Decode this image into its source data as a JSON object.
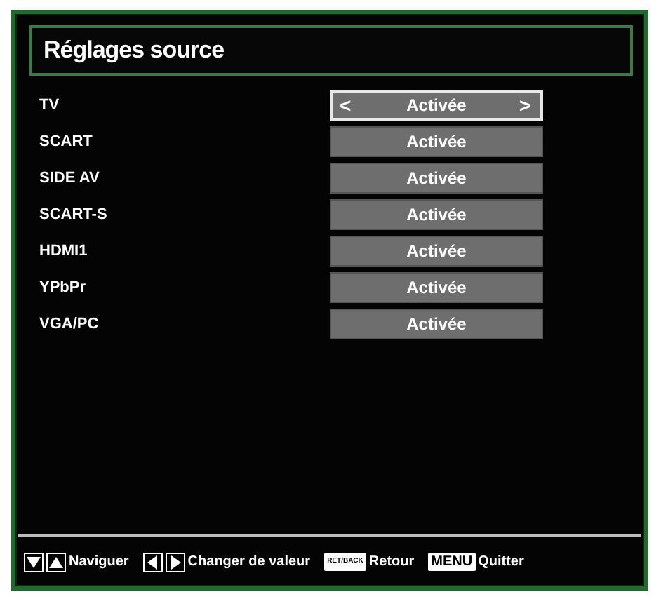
{
  "title": "Réglages source",
  "sources": [
    {
      "label": "TV",
      "value": "Activée",
      "selected": true,
      "prev": "<",
      "next": ">"
    },
    {
      "label": "SCART",
      "value": "Activée",
      "selected": false
    },
    {
      "label": "SIDE AV",
      "value": "Activée",
      "selected": false
    },
    {
      "label": "SCART-S",
      "value": "Activée",
      "selected": false
    },
    {
      "label": "HDMI1",
      "value": "Activée",
      "selected": false
    },
    {
      "label": "YPbPr",
      "value": "Activée",
      "selected": false
    },
    {
      "label": "VGA/PC",
      "value": "Activée",
      "selected": false
    }
  ],
  "footer": [
    {
      "kind": "updown",
      "label": "Naviguer"
    },
    {
      "kind": "leftright",
      "label": "Changer de valeur"
    },
    {
      "kind": "small_key",
      "key": "RET/BACK",
      "label": "Retour"
    },
    {
      "kind": "key",
      "key": "MENU",
      "label": "Quitter"
    }
  ]
}
